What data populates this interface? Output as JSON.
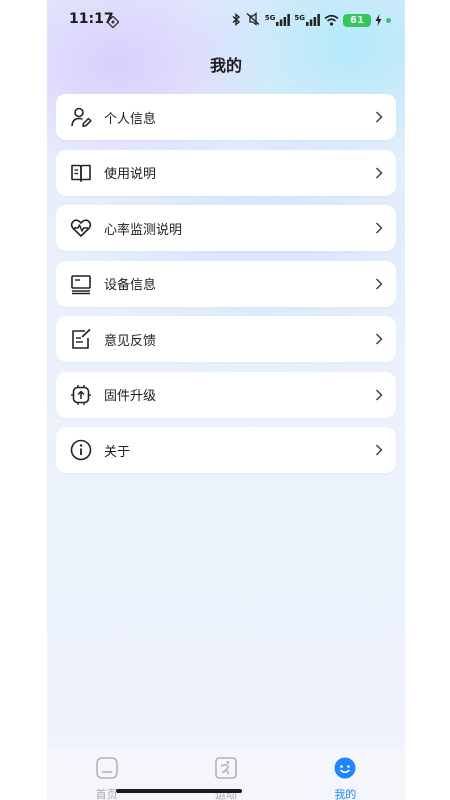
{
  "status_bar": {
    "time": "11:17",
    "network_label_1": "5G",
    "network_label_2": "5G",
    "battery_level": "61",
    "icons": [
      "nfc-icon",
      "bluetooth-icon",
      "mute-icon",
      "signal-icon",
      "wifi-icon",
      "charging-icon"
    ]
  },
  "header": {
    "title": "我的"
  },
  "menu": {
    "items": [
      {
        "label": "个人信息",
        "icon": "user-edit-icon"
      },
      {
        "label": "使用说明",
        "icon": "book-icon"
      },
      {
        "label": "心率监测说明",
        "icon": "heart-rate-icon"
      },
      {
        "label": "设备信息",
        "icon": "device-icon"
      },
      {
        "label": "意见反馈",
        "icon": "feedback-icon"
      },
      {
        "label": "固件升级",
        "icon": "firmware-upgrade-icon"
      },
      {
        "label": "关于",
        "icon": "info-icon"
      }
    ]
  },
  "tab_bar": {
    "tabs": [
      {
        "label": "首页",
        "icon": "home-icon",
        "active": false
      },
      {
        "label": "运动",
        "icon": "sport-icon",
        "active": false
      },
      {
        "label": "我的",
        "icon": "profile-face-icon",
        "active": true
      }
    ],
    "colors": {
      "active": "#1f86ff",
      "inactive": "#a8a8ad"
    }
  }
}
